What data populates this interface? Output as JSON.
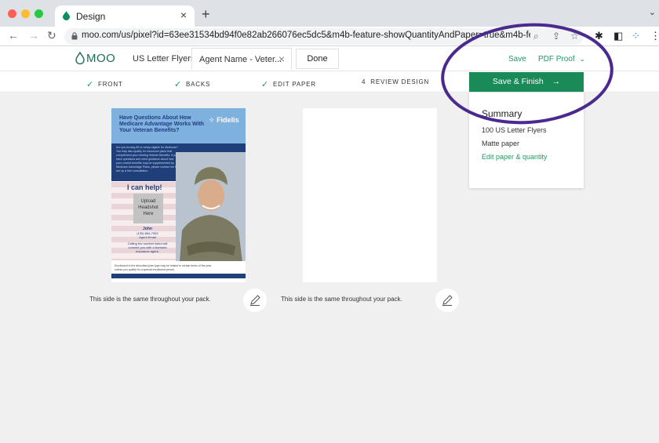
{
  "browser": {
    "tab_title": "Design",
    "url": "moo.com/us/pixel?id=63ee31534bd94f0e82ab266076ec5dc5&m4b-feature-showQuantityAndPaper=true&m4b-fe..."
  },
  "header": {
    "logo": "MOO",
    "product": "US Letter Flyers",
    "name_tab": "Agent Name - Veter...",
    "done": "Done",
    "save": "Save",
    "pdf_proof": "PDF Proof"
  },
  "steps": [
    {
      "label": "FRONT",
      "state": "done"
    },
    {
      "label": "BACKS",
      "state": "done"
    },
    {
      "label": "EDIT PAPER",
      "state": "done"
    },
    {
      "label": "REVIEW DESIGN",
      "number": "4",
      "state": "current"
    }
  ],
  "save_finish": "Save & Finish",
  "summary": {
    "title": "Summary",
    "quantity": "100 US Letter Flyers",
    "paper": "Matte paper",
    "edit_link": "Edit paper & quantity"
  },
  "flyer": {
    "headline": "Have Questions About How Medicare Advantage Works With Your Veteran Benefits?",
    "brand": "Fidelis",
    "body": "Are you turning 65 or newly eligible for Medicare? You may also qualify for insurance plans that complement your existing Veteran Benefits. If you have questions and need guidance about how your current benefits may be supplemented by Medicare Advantage Plans, please contact me to set up a free consultation.",
    "help": "I can help!",
    "headshot": "Upload Headshot Here",
    "agent_name": "John",
    "agent_phone": "(135) 864-7952",
    "agent_title": "Agent Email",
    "agent_note": "Calling the number listed will connect you with a licensed insurance agent.",
    "footer": "Enrollment in the described plan type may be limited to certain times of the year unless you qualify for a special enrollment period."
  },
  "notes": {
    "front": "This side is the same throughout your pack.",
    "back": "This side is the same throughout your pack."
  },
  "colors": {
    "brand_green": "#198a58",
    "annotation": "#4b2a8f"
  },
  "icons": [
    "search-icon",
    "share-icon",
    "star-icon",
    "puzzle-icon",
    "sidebar-icon",
    "menu-icon",
    "pencil-icon",
    "arrow-right-icon",
    "chevron-down-icon",
    "check-icon",
    "close-icon"
  ]
}
